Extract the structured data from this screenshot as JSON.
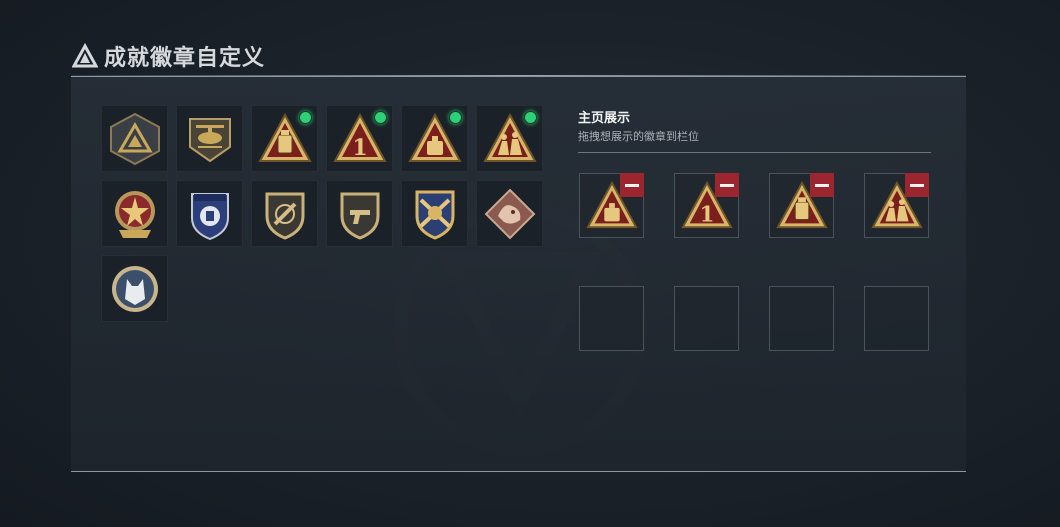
{
  "header": {
    "title": "成就徽章自定义",
    "icon": "triangle-emblem-icon"
  },
  "colors": {
    "accent_green": "#2fd07a",
    "remove_red": "#9b2630",
    "gold": "#c9a85a"
  },
  "inventory": {
    "badges": [
      {
        "icon": "triangle-emblem-badge-icon",
        "new": false
      },
      {
        "icon": "helicopter-badge-icon",
        "new": false
      },
      {
        "icon": "backpack-triangle-badge-icon",
        "new": true
      },
      {
        "icon": "number-one-triangle-badge-icon",
        "new": true
      },
      {
        "icon": "canister-triangle-badge-icon",
        "new": true
      },
      {
        "icon": "soldiers-triangle-badge-icon",
        "new": true
      },
      {
        "icon": "star-medal-badge-icon",
        "new": false
      },
      {
        "icon": "police-shield-badge-icon",
        "new": false
      },
      {
        "icon": "rifle-shield-badge-icon",
        "new": false
      },
      {
        "icon": "pistol-shield-badge-icon",
        "new": false
      },
      {
        "icon": "crossed-rifles-shield-badge-icon",
        "new": false
      },
      {
        "icon": "dragon-diamond-badge-icon",
        "new": false
      },
      {
        "icon": "wolf-circle-badge-icon",
        "new": false
      }
    ]
  },
  "showcase": {
    "title": "主页展示",
    "subtitle": "拖拽想展示的徽章到栏位",
    "slots": [
      {
        "icon": "canister-triangle-badge-icon",
        "filled": true
      },
      {
        "icon": "number-one-triangle-badge-icon",
        "filled": true
      },
      {
        "icon": "backpack-triangle-badge-icon",
        "filled": true
      },
      {
        "icon": "soldiers-triangle-badge-icon",
        "filled": true
      },
      {
        "icon": "",
        "filled": false
      },
      {
        "icon": "",
        "filled": false
      },
      {
        "icon": "",
        "filled": false
      },
      {
        "icon": "",
        "filled": false
      }
    ]
  }
}
